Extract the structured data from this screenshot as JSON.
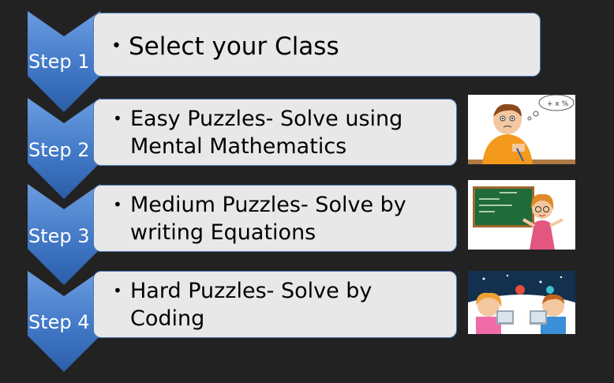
{
  "steps": [
    {
      "label": "Step 1",
      "text": "Select your Class"
    },
    {
      "label": "Step 2",
      "text_line1": "Easy Puzzles- Solve using",
      "text_line2": "Mental Mathematics"
    },
    {
      "label": "Step 3",
      "text_line1": "Medium Puzzles- Solve by",
      "text_line2": "writing Equations"
    },
    {
      "label": "Step 4",
      "text_line1": "Hard Puzzles- Solve by",
      "text_line2": "Coding"
    }
  ],
  "bullet": "•",
  "colors": {
    "background": "#222222",
    "chevron_top": "#5b8fd3",
    "chevron_bottom": "#2f63ad",
    "box_fill": "#e8e8e8",
    "box_border": "#4f79b9"
  },
  "images": {
    "step2": "boy-thinking-math-illustration",
    "step3": "teacher-at-chalkboard-illustration",
    "step4": "kids-at-computers-space-illustration"
  }
}
